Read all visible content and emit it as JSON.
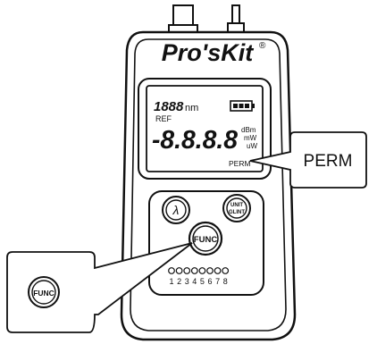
{
  "brand": {
    "name": "Pro'sKit",
    "registered": "®"
  },
  "lcd": {
    "wavelength_digits": "1888",
    "wavelength_unit": "nm",
    "ref_label": "REF",
    "main_readout": "-8.8.8.8",
    "units": [
      "dBm",
      "mW",
      "uW"
    ],
    "perm_indicator": "PERM"
  },
  "buttons": {
    "lambda": "λ",
    "unit_glint": [
      "UNIT",
      "GLINT"
    ],
    "func": "FUNC"
  },
  "led_numbers": [
    "1",
    "2",
    "3",
    "4",
    "5",
    "6",
    "7",
    "8"
  ],
  "callouts": {
    "perm": "PERM",
    "func": "FUNC"
  }
}
